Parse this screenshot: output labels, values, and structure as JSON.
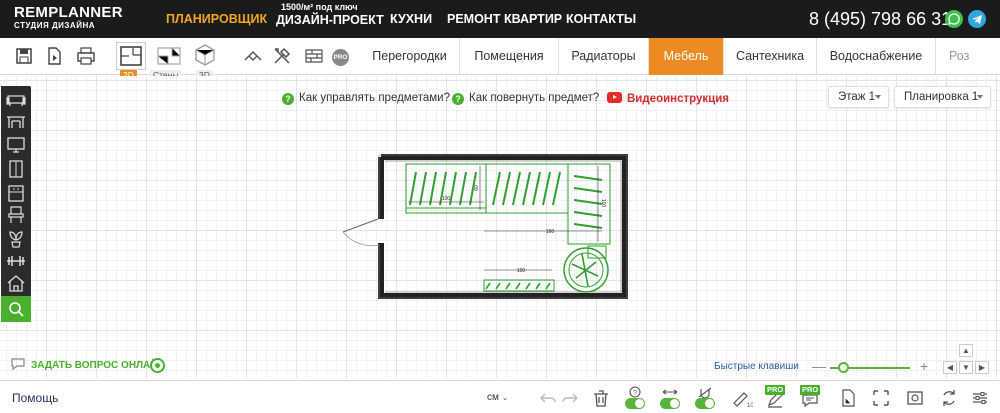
{
  "brand": {
    "name": "REMPLANNER",
    "sub": "СТУДИЯ ДИЗАЙНА"
  },
  "nav": {
    "items": [
      "ПЛАНИРОВЩИК",
      "ДИЗАЙН-ПРОЕКТ",
      "КУХНИ",
      "РЕМОНТ КВАРТИР",
      "КОНТАКТЫ"
    ],
    "promo": "1500/м² под ключ",
    "phone": "8 (495) 798 66 31"
  },
  "toolbar": {
    "views": {
      "v2d": "2D",
      "walls": "Стены",
      "v3d": "3D"
    },
    "pro": "PRO",
    "tabs": [
      "Перегородки",
      "Помещения",
      "Радиаторы",
      "Мебель",
      "Сантехника",
      "Водоснабжение",
      "Роз"
    ]
  },
  "help": {
    "manage": "Как управлять предметами?",
    "rotate": "Как повернуть предмет?",
    "video": "Видеоинструкция"
  },
  "dropdowns": {
    "floor": "Этаж 1",
    "plan": "Планировка 1"
  },
  "plan": {
    "dims": {
      "d100a": "100",
      "d60": "60",
      "d100b": "100",
      "d160": "160",
      "d100c": "100"
    }
  },
  "ask": "ЗАДАТЬ ВОПРОС ОНЛАЙН",
  "hotkeys": "Быстрые клавиши",
  "zoom": {
    "minus": "—",
    "plus": "+"
  },
  "bottom": {
    "help": "Помощь",
    "unit": "см",
    "pro": "PRO"
  },
  "colors": {
    "accent": "#ec8b22",
    "green": "#48b02c",
    "dark": "#1b1b1b"
  }
}
